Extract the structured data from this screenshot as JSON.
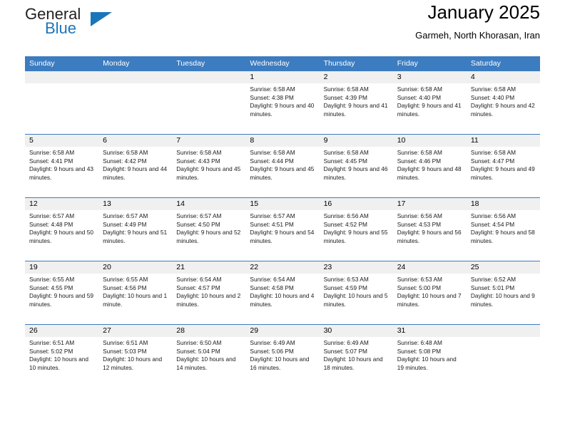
{
  "brand": {
    "name_top": "General",
    "name_bottom": "Blue",
    "color_top": "#231f20",
    "color_bottom": "#1b75bb",
    "triangle_color": "#1b75bb"
  },
  "header": {
    "title": "January 2025",
    "subtitle": "Garmeh, North Khorasan, Iran"
  },
  "theme": {
    "header_bg": "#3c7cc0",
    "header_text": "#ffffff",
    "daynum_bg": "#f0f0f0",
    "cell_border": "#3c7cc0"
  },
  "weekdays": [
    "Sunday",
    "Monday",
    "Tuesday",
    "Wednesday",
    "Thursday",
    "Friday",
    "Saturday"
  ],
  "labels": {
    "sunrise": "Sunrise:",
    "sunset": "Sunset:",
    "daylight": "Daylight:"
  },
  "weeks": [
    [
      {
        "day": "",
        "sunrise": "",
        "sunset": "",
        "daylight": ""
      },
      {
        "day": "",
        "sunrise": "",
        "sunset": "",
        "daylight": ""
      },
      {
        "day": "",
        "sunrise": "",
        "sunset": "",
        "daylight": ""
      },
      {
        "day": "1",
        "sunrise": "Sunrise: 6:58 AM",
        "sunset": "Sunset: 4:38 PM",
        "daylight": "Daylight: 9 hours and 40 minutes."
      },
      {
        "day": "2",
        "sunrise": "Sunrise: 6:58 AM",
        "sunset": "Sunset: 4:39 PM",
        "daylight": "Daylight: 9 hours and 41 minutes."
      },
      {
        "day": "3",
        "sunrise": "Sunrise: 6:58 AM",
        "sunset": "Sunset: 4:40 PM",
        "daylight": "Daylight: 9 hours and 41 minutes."
      },
      {
        "day": "4",
        "sunrise": "Sunrise: 6:58 AM",
        "sunset": "Sunset: 4:40 PM",
        "daylight": "Daylight: 9 hours and 42 minutes."
      }
    ],
    [
      {
        "day": "5",
        "sunrise": "Sunrise: 6:58 AM",
        "sunset": "Sunset: 4:41 PM",
        "daylight": "Daylight: 9 hours and 43 minutes."
      },
      {
        "day": "6",
        "sunrise": "Sunrise: 6:58 AM",
        "sunset": "Sunset: 4:42 PM",
        "daylight": "Daylight: 9 hours and 44 minutes."
      },
      {
        "day": "7",
        "sunrise": "Sunrise: 6:58 AM",
        "sunset": "Sunset: 4:43 PM",
        "daylight": "Daylight: 9 hours and 45 minutes."
      },
      {
        "day": "8",
        "sunrise": "Sunrise: 6:58 AM",
        "sunset": "Sunset: 4:44 PM",
        "daylight": "Daylight: 9 hours and 45 minutes."
      },
      {
        "day": "9",
        "sunrise": "Sunrise: 6:58 AM",
        "sunset": "Sunset: 4:45 PM",
        "daylight": "Daylight: 9 hours and 46 minutes."
      },
      {
        "day": "10",
        "sunrise": "Sunrise: 6:58 AM",
        "sunset": "Sunset: 4:46 PM",
        "daylight": "Daylight: 9 hours and 48 minutes."
      },
      {
        "day": "11",
        "sunrise": "Sunrise: 6:58 AM",
        "sunset": "Sunset: 4:47 PM",
        "daylight": "Daylight: 9 hours and 49 minutes."
      }
    ],
    [
      {
        "day": "12",
        "sunrise": "Sunrise: 6:57 AM",
        "sunset": "Sunset: 4:48 PM",
        "daylight": "Daylight: 9 hours and 50 minutes."
      },
      {
        "day": "13",
        "sunrise": "Sunrise: 6:57 AM",
        "sunset": "Sunset: 4:49 PM",
        "daylight": "Daylight: 9 hours and 51 minutes."
      },
      {
        "day": "14",
        "sunrise": "Sunrise: 6:57 AM",
        "sunset": "Sunset: 4:50 PM",
        "daylight": "Daylight: 9 hours and 52 minutes."
      },
      {
        "day": "15",
        "sunrise": "Sunrise: 6:57 AM",
        "sunset": "Sunset: 4:51 PM",
        "daylight": "Daylight: 9 hours and 54 minutes."
      },
      {
        "day": "16",
        "sunrise": "Sunrise: 6:56 AM",
        "sunset": "Sunset: 4:52 PM",
        "daylight": "Daylight: 9 hours and 55 minutes."
      },
      {
        "day": "17",
        "sunrise": "Sunrise: 6:56 AM",
        "sunset": "Sunset: 4:53 PM",
        "daylight": "Daylight: 9 hours and 56 minutes."
      },
      {
        "day": "18",
        "sunrise": "Sunrise: 6:56 AM",
        "sunset": "Sunset: 4:54 PM",
        "daylight": "Daylight: 9 hours and 58 minutes."
      }
    ],
    [
      {
        "day": "19",
        "sunrise": "Sunrise: 6:55 AM",
        "sunset": "Sunset: 4:55 PM",
        "daylight": "Daylight: 9 hours and 59 minutes."
      },
      {
        "day": "20",
        "sunrise": "Sunrise: 6:55 AM",
        "sunset": "Sunset: 4:56 PM",
        "daylight": "Daylight: 10 hours and 1 minute."
      },
      {
        "day": "21",
        "sunrise": "Sunrise: 6:54 AM",
        "sunset": "Sunset: 4:57 PM",
        "daylight": "Daylight: 10 hours and 2 minutes."
      },
      {
        "day": "22",
        "sunrise": "Sunrise: 6:54 AM",
        "sunset": "Sunset: 4:58 PM",
        "daylight": "Daylight: 10 hours and 4 minutes."
      },
      {
        "day": "23",
        "sunrise": "Sunrise: 6:53 AM",
        "sunset": "Sunset: 4:59 PM",
        "daylight": "Daylight: 10 hours and 5 minutes."
      },
      {
        "day": "24",
        "sunrise": "Sunrise: 6:53 AM",
        "sunset": "Sunset: 5:00 PM",
        "daylight": "Daylight: 10 hours and 7 minutes."
      },
      {
        "day": "25",
        "sunrise": "Sunrise: 6:52 AM",
        "sunset": "Sunset: 5:01 PM",
        "daylight": "Daylight: 10 hours and 9 minutes."
      }
    ],
    [
      {
        "day": "26",
        "sunrise": "Sunrise: 6:51 AM",
        "sunset": "Sunset: 5:02 PM",
        "daylight": "Daylight: 10 hours and 10 minutes."
      },
      {
        "day": "27",
        "sunrise": "Sunrise: 6:51 AM",
        "sunset": "Sunset: 5:03 PM",
        "daylight": "Daylight: 10 hours and 12 minutes."
      },
      {
        "day": "28",
        "sunrise": "Sunrise: 6:50 AM",
        "sunset": "Sunset: 5:04 PM",
        "daylight": "Daylight: 10 hours and 14 minutes."
      },
      {
        "day": "29",
        "sunrise": "Sunrise: 6:49 AM",
        "sunset": "Sunset: 5:06 PM",
        "daylight": "Daylight: 10 hours and 16 minutes."
      },
      {
        "day": "30",
        "sunrise": "Sunrise: 6:49 AM",
        "sunset": "Sunset: 5:07 PM",
        "daylight": "Daylight: 10 hours and 18 minutes."
      },
      {
        "day": "31",
        "sunrise": "Sunrise: 6:48 AM",
        "sunset": "Sunset: 5:08 PM",
        "daylight": "Daylight: 10 hours and 19 minutes."
      },
      {
        "day": "",
        "sunrise": "",
        "sunset": "",
        "daylight": ""
      }
    ]
  ]
}
